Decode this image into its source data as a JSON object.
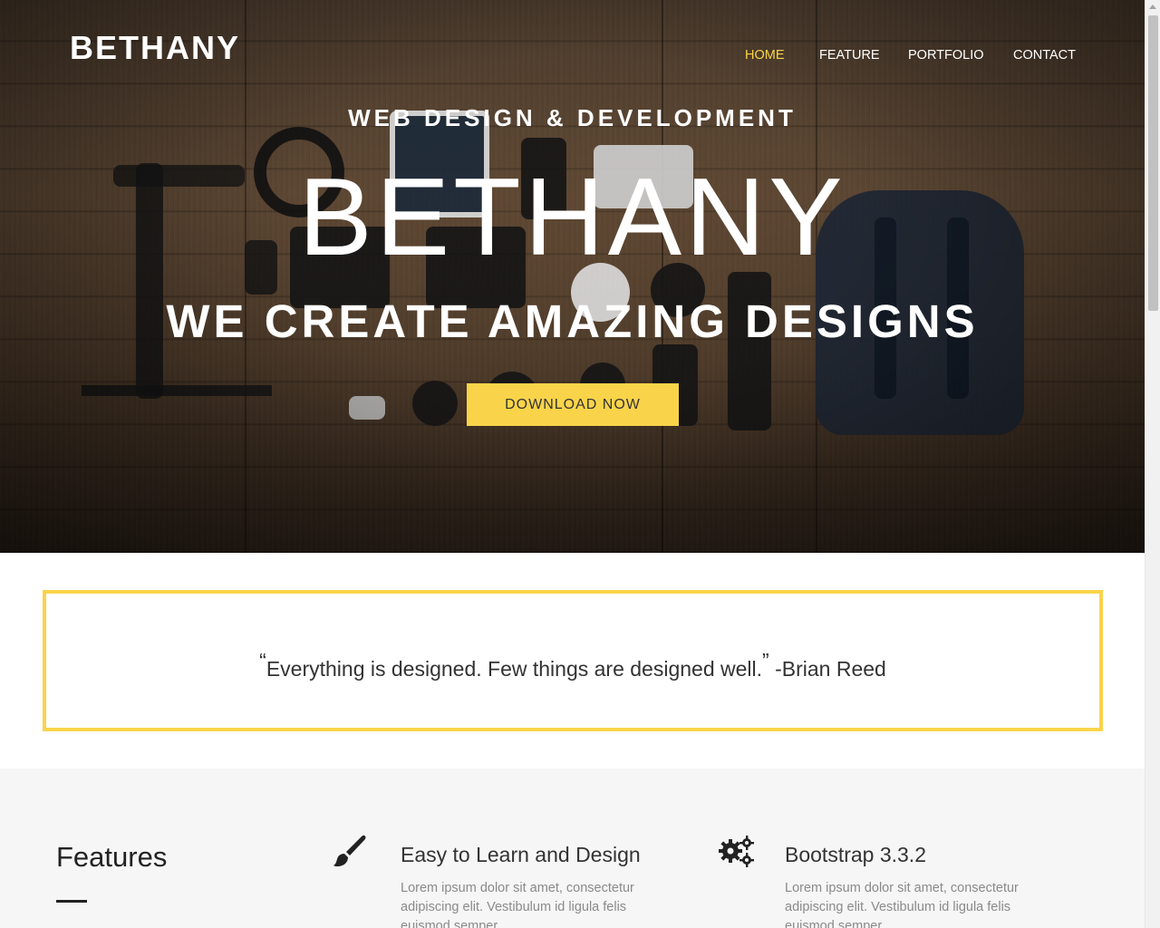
{
  "brand": "BETHANY",
  "nav": {
    "items": [
      {
        "label": "HOME",
        "active": true
      },
      {
        "label": "FEATURE",
        "active": false
      },
      {
        "label": "PORTFOLIO",
        "active": false
      },
      {
        "label": "CONTACT",
        "active": false
      }
    ]
  },
  "hero": {
    "subtitle": "WEB DESIGN & DEVELOPMENT",
    "title": "BETHANY",
    "tagline": "WE CREATE AMAZING DESIGNS",
    "button_label": "DOWNLOAD NOW"
  },
  "quote": {
    "open_mark": "“",
    "text": "Everything is designed. Few things are designed well.",
    "close_mark": "”",
    "author": "-Brian Reed"
  },
  "features": {
    "title": "Features",
    "items": [
      {
        "icon": "paint-brush-icon",
        "heading": "Easy to Learn and Design",
        "body": "Lorem ipsum dolor sit amet, consectetur adipiscing elit. Vestibulum id ligula felis euismod semper."
      },
      {
        "icon": "gears-icon",
        "heading": "Bootstrap 3.3.2",
        "body": "Lorem ipsum dolor sit amet, consectetur adipiscing elit. Vestibulum id ligula felis euismod semper."
      }
    ]
  },
  "colors": {
    "accent": "#f9d44a",
    "text_dark": "#333333",
    "features_bg": "#f6f6f6"
  }
}
